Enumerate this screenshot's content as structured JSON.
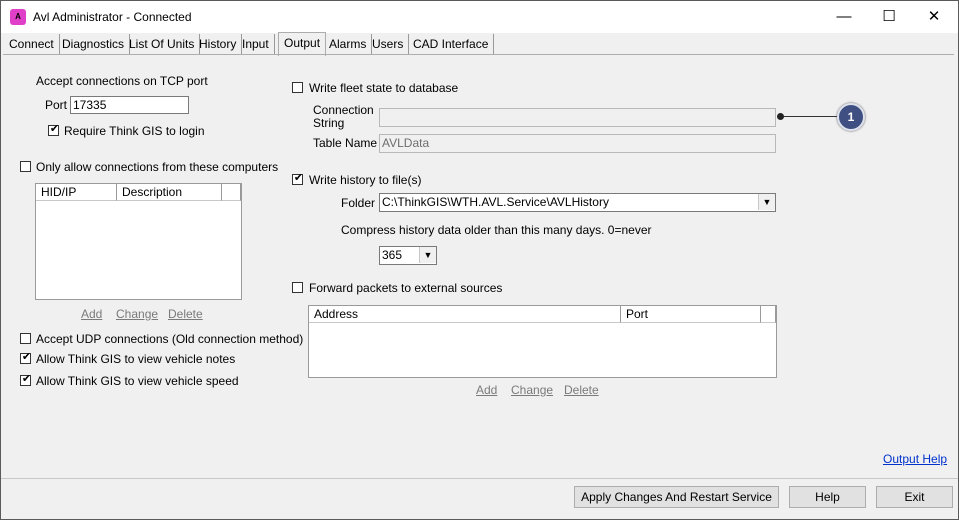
{
  "window": {
    "title": "Avl Administrator - Connected",
    "minimize": "—",
    "maximize": "☐",
    "close": "✕"
  },
  "tabs": [
    "Connect",
    "Diagnostics",
    "List Of Units",
    "History",
    "Input",
    "Output",
    "Alarms",
    "Users",
    "CAD Interface"
  ],
  "active_tab": "Output",
  "left": {
    "tcp_heading": "Accept connections on TCP port",
    "port_label": "Port",
    "port_value": "17335",
    "require_login_label": "Require Think GIS to login",
    "require_login_checked": true,
    "only_allow_label": "Only allow connections from these computers",
    "only_allow_checked": false,
    "list_columns": [
      "HID/IP",
      "Description"
    ],
    "add": "Add",
    "change": "Change",
    "delete": "Delete",
    "udp_label": "Accept UDP connections (Old connection method)",
    "udp_checked": false,
    "notes_label": "Allow Think GIS to view vehicle notes",
    "notes_checked": true,
    "speed_label": "Allow Think GIS to view vehicle speed",
    "speed_checked": true
  },
  "right": {
    "write_fleet_label": "Write fleet state to database",
    "write_fleet_checked": false,
    "conn_string_label_1": "Connection",
    "conn_string_label_2": "String",
    "conn_string_value": "",
    "table_name_label": "Table Name",
    "table_name_value": "AVLData",
    "write_history_label": "Write history to file(s)",
    "write_history_checked": true,
    "folder_label": "Folder",
    "folder_value": "C:\\ThinkGIS\\WTH.AVL.Service\\AVLHistory",
    "compress_label": "Compress history data older than this many days.  0=never",
    "compress_value": "365",
    "forward_label": "Forward packets to external sources",
    "forward_checked": false,
    "forward_columns": [
      "Address",
      "Port"
    ],
    "add": "Add",
    "change": "Change",
    "delete": "Delete"
  },
  "callout": "1",
  "output_help": "Output Help",
  "buttons": {
    "apply": "Apply Changes And Restart Service",
    "help": "Help",
    "exit": "Exit"
  }
}
